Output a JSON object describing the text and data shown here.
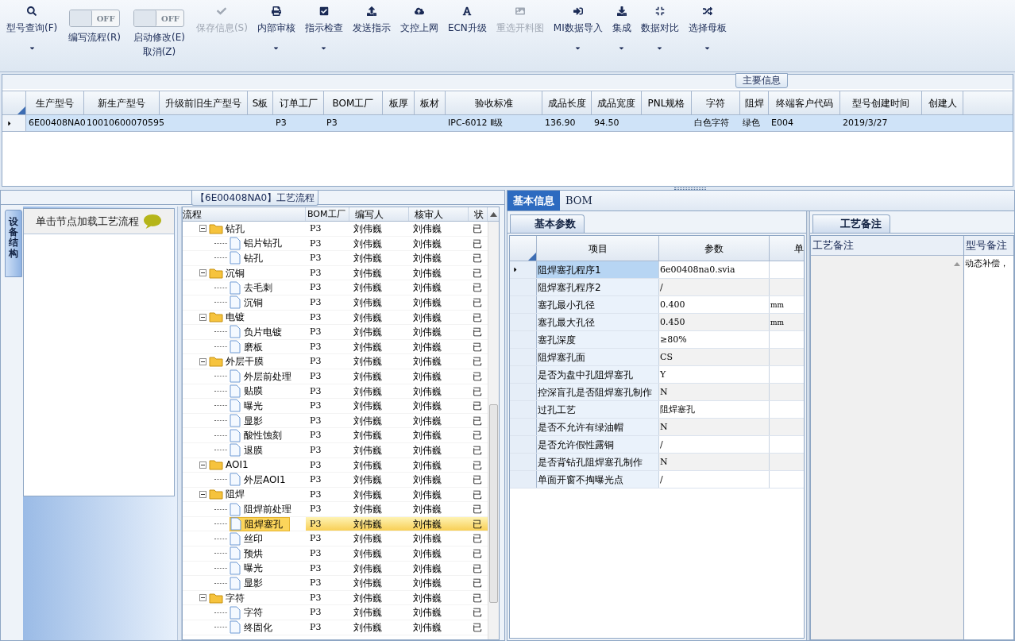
{
  "toolbar": [
    {
      "kind": "button",
      "label": "型号查询(F)",
      "has_menu": true,
      "disabled": false
    },
    {
      "kind": "toggle",
      "switch_text": "OFF",
      "on": false,
      "label": "编写流程(R)"
    },
    {
      "kind": "toggle",
      "switch_text": "OFF",
      "on": false,
      "label": "启动修改(E)",
      "label_2": "取消(Z)"
    },
    {
      "kind": "button",
      "label": "保存信息(S)",
      "has_menu": false,
      "disabled": true
    },
    {
      "kind": "button",
      "label": "内部审核",
      "has_menu": true,
      "disabled": false
    },
    {
      "kind": "button",
      "label": "指示检查",
      "has_menu": true,
      "disabled": false
    },
    {
      "kind": "button",
      "label": "发送指示",
      "has_menu": false,
      "disabled": false
    },
    {
      "kind": "button",
      "label": "文控上网",
      "has_menu": false,
      "disabled": false
    },
    {
      "kind": "button",
      "label": "ECN升级",
      "has_menu": false,
      "disabled": false
    },
    {
      "kind": "button",
      "label": "重选开料图",
      "has_menu": false,
      "disabled": true
    },
    {
      "kind": "button",
      "label": "MI数据导入",
      "has_menu": true,
      "disabled": false
    },
    {
      "kind": "button",
      "label": "集成",
      "has_menu": true,
      "disabled": false
    },
    {
      "kind": "button",
      "label": "数据对比",
      "has_menu": true,
      "disabled": false
    },
    {
      "kind": "button",
      "label": "选择母板",
      "has_menu": true,
      "disabled": false
    }
  ],
  "main_info": {
    "title": "主要信息",
    "columns": [
      "生产型号",
      "新生产型号",
      "升级前旧生产型号",
      "S板",
      "订单工厂",
      "BOM工厂",
      "板厚",
      "板材",
      "验收标准",
      "成品长度",
      "成品宽度",
      "PNL规格",
      "字符",
      "阻焊",
      "终端客户代码",
      "型号创建时间",
      "创建人"
    ],
    "rows": [
      {
        "selected": true,
        "cells": [
          "6E00408NA0",
          "10010600070595",
          null,
          null,
          "P3",
          "P3",
          null,
          null,
          "IPC-6012 Ⅱ级",
          "136.90",
          "94.50",
          null,
          "白色字符",
          "绿色",
          "E004",
          "2019/3/27",
          null
        ]
      }
    ]
  },
  "flow_panel": {
    "title": "【6E00408NA0】工艺流程",
    "side_tab": "设备结构",
    "hint": "单击节点加载工艺流程",
    "columns": [
      "流程",
      "BOM工厂",
      "编写人",
      "核审人",
      "状"
    ],
    "tree": [
      {
        "name": "钻孔",
        "bom": "P3",
        "writer": "刘伟巍",
        "reviewer": "刘伟巍",
        "status": "已",
        "expanded": true,
        "selected": false,
        "children": [
          {
            "name": "铝片钻孔",
            "bom": "P3",
            "writer": "刘伟巍",
            "reviewer": "刘伟巍",
            "status": "已",
            "selected": false
          },
          {
            "name": "钻孔",
            "bom": "P3",
            "writer": "刘伟巍",
            "reviewer": "刘伟巍",
            "status": "已",
            "selected": false
          }
        ]
      },
      {
        "name": "沉铜",
        "bom": "P3",
        "writer": "刘伟巍",
        "reviewer": "刘伟巍",
        "status": "已",
        "expanded": true,
        "selected": false,
        "children": [
          {
            "name": "去毛刺",
            "bom": "P3",
            "writer": "刘伟巍",
            "reviewer": "刘伟巍",
            "status": "已",
            "selected": false
          },
          {
            "name": "沉铜",
            "bom": "P3",
            "writer": "刘伟巍",
            "reviewer": "刘伟巍",
            "status": "已",
            "selected": false
          }
        ]
      },
      {
        "name": "电镀",
        "bom": "P3",
        "writer": "刘伟巍",
        "reviewer": "刘伟巍",
        "status": "已",
        "expanded": true,
        "selected": false,
        "children": [
          {
            "name": "负片电镀",
            "bom": "P3",
            "writer": "刘伟巍",
            "reviewer": "刘伟巍",
            "status": "已",
            "selected": false
          },
          {
            "name": "磨板",
            "bom": "P3",
            "writer": "刘伟巍",
            "reviewer": "刘伟巍",
            "status": "已",
            "selected": false
          }
        ]
      },
      {
        "name": "外层干膜",
        "bom": "P3",
        "writer": "刘伟巍",
        "reviewer": "刘伟巍",
        "status": "已",
        "expanded": true,
        "selected": false,
        "children": [
          {
            "name": "外层前处理",
            "bom": "P3",
            "writer": "刘伟巍",
            "reviewer": "刘伟巍",
            "status": "已",
            "selected": false
          },
          {
            "name": "贴膜",
            "bom": "P3",
            "writer": "刘伟巍",
            "reviewer": "刘伟巍",
            "status": "已",
            "selected": false
          },
          {
            "name": "曝光",
            "bom": "P3",
            "writer": "刘伟巍",
            "reviewer": "刘伟巍",
            "status": "已",
            "selected": false
          },
          {
            "name": "显影",
            "bom": "P3",
            "writer": "刘伟巍",
            "reviewer": "刘伟巍",
            "status": "已",
            "selected": false
          },
          {
            "name": "酸性蚀刻",
            "bom": "P3",
            "writer": "刘伟巍",
            "reviewer": "刘伟巍",
            "status": "已",
            "selected": false
          },
          {
            "name": "退膜",
            "bom": "P3",
            "writer": "刘伟巍",
            "reviewer": "刘伟巍",
            "status": "已",
            "selected": false
          }
        ]
      },
      {
        "name": "AOI1",
        "bom": "P3",
        "writer": "刘伟巍",
        "reviewer": "刘伟巍",
        "status": "已",
        "expanded": true,
        "selected": false,
        "children": [
          {
            "name": "外层AOI1",
            "bom": "P3",
            "writer": "刘伟巍",
            "reviewer": "刘伟巍",
            "status": "已",
            "selected": false
          }
        ]
      },
      {
        "name": "阻焊",
        "bom": "P3",
        "writer": "刘伟巍",
        "reviewer": "刘伟巍",
        "status": "已",
        "expanded": true,
        "selected": false,
        "children": [
          {
            "name": "阻焊前处理",
            "bom": "P3",
            "writer": "刘伟巍",
            "reviewer": "刘伟巍",
            "status": "已",
            "selected": false
          },
          {
            "name": "阻焊塞孔",
            "bom": "P3",
            "writer": "刘伟巍",
            "reviewer": "刘伟巍",
            "status": "已",
            "selected": true
          },
          {
            "name": "丝印",
            "bom": "P3",
            "writer": "刘伟巍",
            "reviewer": "刘伟巍",
            "status": "已",
            "selected": false
          },
          {
            "name": "预烘",
            "bom": "P3",
            "writer": "刘伟巍",
            "reviewer": "刘伟巍",
            "status": "已",
            "selected": false
          },
          {
            "name": "曝光",
            "bom": "P3",
            "writer": "刘伟巍",
            "reviewer": "刘伟巍",
            "status": "已",
            "selected": false
          },
          {
            "name": "显影",
            "bom": "P3",
            "writer": "刘伟巍",
            "reviewer": "刘伟巍",
            "status": "已",
            "selected": false
          }
        ]
      },
      {
        "name": "字符",
        "bom": "P3",
        "writer": "刘伟巍",
        "reviewer": "刘伟巍",
        "status": "已",
        "expanded": true,
        "selected": false,
        "children": [
          {
            "name": "字符",
            "bom": "P3",
            "writer": "刘伟巍",
            "reviewer": "刘伟巍",
            "status": "已",
            "selected": false
          },
          {
            "name": "终固化",
            "bom": "P3",
            "writer": "刘伟巍",
            "reviewer": "刘伟巍",
            "status": "已",
            "selected": false
          }
        ]
      }
    ]
  },
  "detail_tabs": [
    {
      "label": "基本信息",
      "selected": true
    },
    {
      "label": "BOM",
      "selected": false
    }
  ],
  "params": {
    "tab": "基本参数",
    "columns": [
      "项目",
      "参数",
      "单"
    ],
    "rows": [
      {
        "item": "阻焊塞孔程序1",
        "value": "6e00408na0.svia",
        "selected": true
      },
      {
        "item": "阻焊塞孔程序2",
        "value": "/",
        "selected": false
      },
      {
        "item": "塞孔最小孔径",
        "value": "0.400",
        "unit": "mm",
        "selected": false
      },
      {
        "item": "塞孔最大孔径",
        "value": "0.450",
        "unit": "mm",
        "selected": false
      },
      {
        "item": "塞孔深度",
        "value": "≥80%",
        "selected": false
      },
      {
        "item": "阻焊塞孔面",
        "value": "CS",
        "selected": false
      },
      {
        "item": "是否为盘中孔阻焊塞孔",
        "value": "Y",
        "selected": false
      },
      {
        "item": "控深盲孔是否阻焊塞孔制作",
        "value": "N",
        "selected": false
      },
      {
        "item": "过孔工艺",
        "value": "阻焊塞孔",
        "selected": false
      },
      {
        "item": "是否不允许有绿油帽",
        "value": "N",
        "selected": false
      },
      {
        "item": "是否允许假性露铜",
        "value": "/",
        "selected": false
      },
      {
        "item": "是否背钻孔阻焊塞孔制作",
        "value": "N",
        "selected": false
      },
      {
        "item": "单面开窗不掏曝光点",
        "value": "/",
        "selected": false
      }
    ]
  },
  "notes": {
    "tab": "工艺备注",
    "columns": [
      "工艺备注",
      "型号备注"
    ],
    "model_note": "动态补偿，"
  }
}
